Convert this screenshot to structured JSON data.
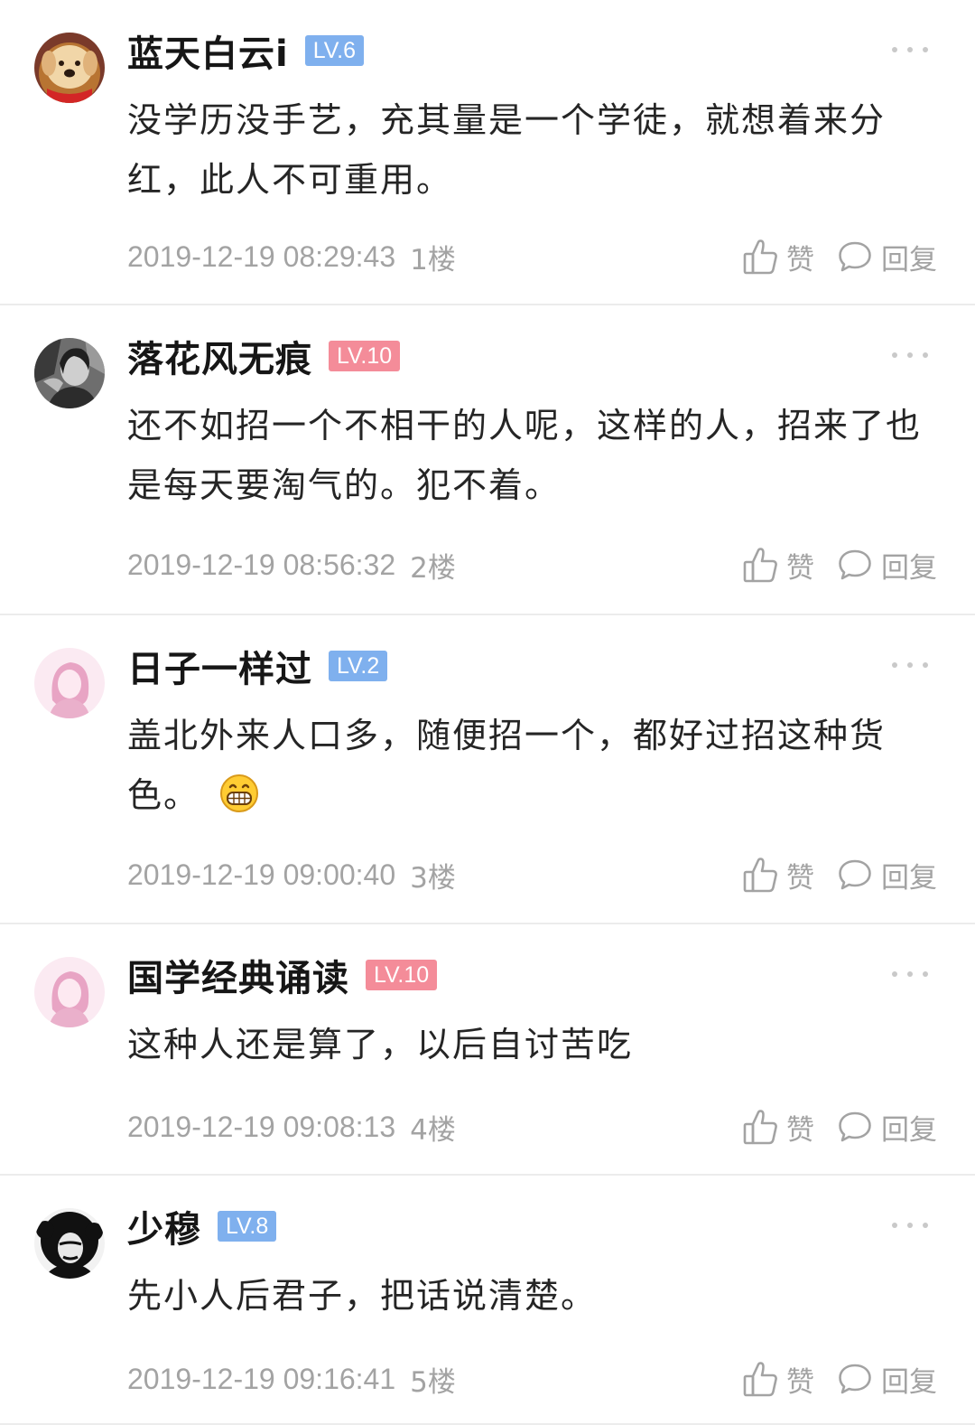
{
  "colors": {
    "badge_blue": "#7fb0ee",
    "badge_pink": "#f48c99",
    "meta_gray": "#a3a3a3",
    "divider": "#ececec"
  },
  "like_label": "赞",
  "reply_label": "回复",
  "comments": [
    {
      "username": "蓝天白云i",
      "level": "LV.6",
      "level_color": "#7fb0ee",
      "avatar": "dog-avatar",
      "content": "没学历没手艺，充其量是一个学徒，就想着来分红，此人不可重用。",
      "emoji": "",
      "time": "2019-12-19 08:29:43",
      "floor": "1楼"
    },
    {
      "username": "落花风无痕",
      "level": "LV.10",
      "level_color": "#f48c99",
      "avatar": "woman-photo-avatar",
      "content": "还不如招一个不相干的人呢，这样的人，招来了也是每天要淘气的。犯不着。",
      "emoji": "",
      "time": "2019-12-19 08:56:32",
      "floor": "2楼"
    },
    {
      "username": "日子一样过",
      "level": "LV.2",
      "level_color": "#7fb0ee",
      "avatar": "pink-default-avatar",
      "content": "盖北外来人口多，随便招一个，都好过招这种货色。",
      "emoji": "grinning-emoji",
      "time": "2019-12-19 09:00:40",
      "floor": "3楼"
    },
    {
      "username": "国学经典诵读",
      "level": "LV.10",
      "level_color": "#f48c99",
      "avatar": "pink-default-avatar",
      "content": "这种人还是算了，以后自讨苦吃",
      "emoji": "",
      "time": "2019-12-19 09:08:13",
      "floor": "4楼"
    },
    {
      "username": "少穆",
      "level": "LV.8",
      "level_color": "#7fb0ee",
      "avatar": "afro-portrait-avatar",
      "content": "先小人后君子，把话说清楚。",
      "emoji": "",
      "time": "2019-12-19 09:16:41",
      "floor": "5楼"
    }
  ]
}
